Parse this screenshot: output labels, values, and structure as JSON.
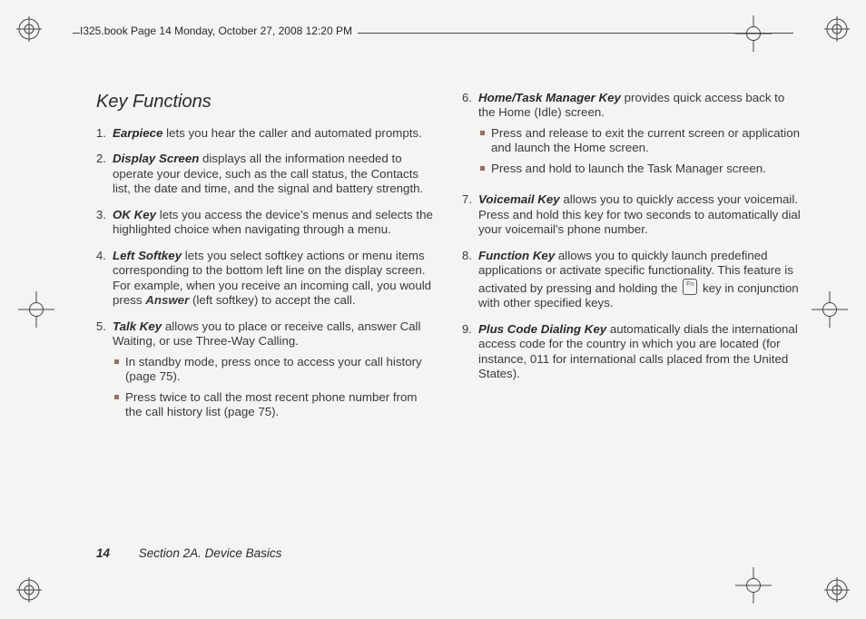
{
  "header": {
    "stamp": "I325.book  Page 14  Monday, October 27, 2008  12:20 PM"
  },
  "title": "Key Functions",
  "left_items": [
    {
      "n": "1.",
      "term": "Earpiece",
      "rest": " lets you hear the caller and automated prompts."
    },
    {
      "n": "2.",
      "term": "Display Screen",
      "rest": " displays all the information needed to operate your device, such as the call status, the Contacts list, the date and time, and the signal and battery strength."
    },
    {
      "n": "3.",
      "term": "OK Key",
      "rest": " lets you access the device's menus and selects the highlighted choice when navigating through a menu."
    },
    {
      "n": "4.",
      "term": "Left Softkey",
      "rest": " lets you select softkey actions or menu items corresponding to the bottom left line on the display screen. For example, when you receive an incoming call, you would press ",
      "term2": "Answer",
      "rest2": " (left softkey) to accept the call."
    },
    {
      "n": "5.",
      "term": "Talk Key",
      "rest": " allows you to place or receive calls, answer Call Waiting, or use Three-Way Calling.",
      "subs": [
        "In standby mode, press once to access your call history (page 75).",
        "Press twice to call the most recent phone number from the call history list (page 75)."
      ]
    }
  ],
  "right_items": [
    {
      "n": "6.",
      "term": "Home/Task Manager Key",
      "rest": " provides quick access back to the Home (Idle) screen.",
      "subs": [
        "Press and release to exit the current screen or application and launch the Home screen.",
        "Press and hold to launch the Task Manager screen."
      ]
    },
    {
      "n": "7.",
      "term": "Voicemail Key",
      "rest": " allows you to quickly access your voicemail. Press and hold this key for two seconds to automatically dial your voicemail's phone number."
    },
    {
      "n": "8.",
      "term": "Function Key",
      "rest": " allows you to quickly launch predefined applications or activate specific functionality. This feature is activated by pressing and holding the ",
      "icon": true,
      "rest2": " key in conjunction with other specified keys."
    },
    {
      "n": "9.",
      "term": "Plus Code Dialing Key",
      "rest": " automatically dials the international access code for the country in which you are located (for instance, 011 for international calls placed from the United States)."
    }
  ],
  "footer": {
    "page": "14",
    "section": "Section 2A. Device Basics"
  }
}
